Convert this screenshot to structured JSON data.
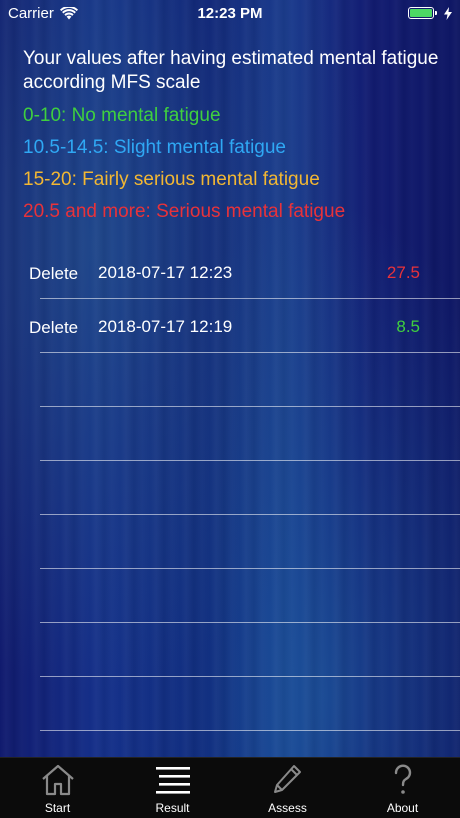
{
  "status_bar": {
    "carrier": "Carrier",
    "time": "12:23 PM",
    "battery_color": "#4cd964"
  },
  "intro": "Your values after having estimated mental fatigue according MFS scale",
  "legend": [
    {
      "text": "0-10: No mental fatigue",
      "color": "#3fcf3f"
    },
    {
      "text": "10.5-14.5: Slight mental fatigue",
      "color": "#2fa8f4"
    },
    {
      "text": "15-20: Fairly serious mental fatigue",
      "color": "#f2b733"
    },
    {
      "text": "20.5 and more: Serious mental fatigue",
      "color": "#e8323a"
    }
  ],
  "entries": [
    {
      "delete_label": "Delete",
      "date": "2018-07-17 12:23",
      "value": "27.5",
      "value_color": "#e8323a"
    },
    {
      "delete_label": "Delete",
      "date": "2018-07-17 12:19",
      "value": "8.5",
      "value_color": "#3fcf3f"
    }
  ],
  "tabs": [
    {
      "label": "Start",
      "icon": "home-icon"
    },
    {
      "label": "Result",
      "icon": "list-icon"
    },
    {
      "label": "Assess",
      "icon": "pencil-icon"
    },
    {
      "label": "About",
      "icon": "question-icon"
    }
  ]
}
